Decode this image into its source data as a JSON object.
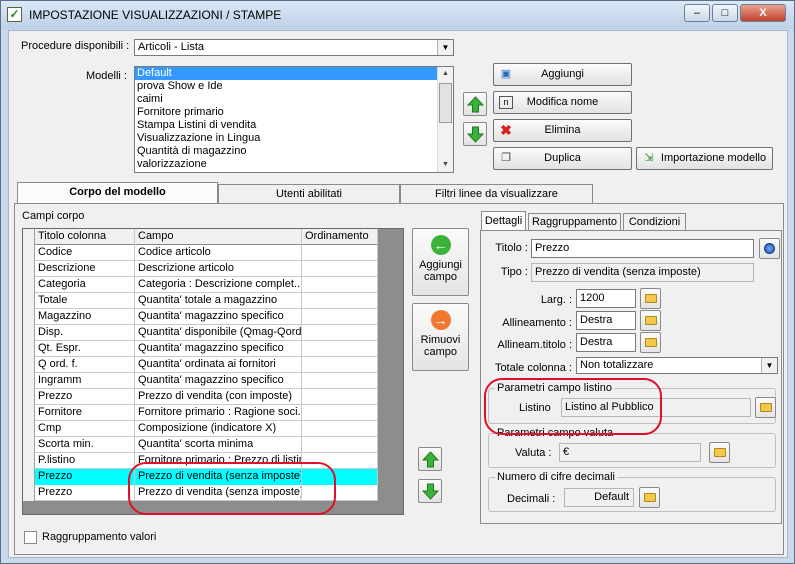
{
  "window": {
    "title": "IMPOSTAZIONE VISUALIZZAZIONI / STAMPE",
    "min": "–",
    "max": "□",
    "close": "X"
  },
  "top": {
    "procedure_label": "Procedure disponibili :",
    "procedure_value": "Articoli - Lista",
    "modelli_label": "Modelli :",
    "modelli": [
      "Default",
      "prova Show e Ide",
      "caimi",
      "Fornitore primario",
      "Stampa Listini di vendita",
      "Visualizzazione in Lingua",
      "Quantità di magazzino",
      "valorizzazione"
    ],
    "buttons": {
      "aggiungi": "Aggiungi",
      "modifica": "Modifica nome",
      "elimina": "Elimina",
      "duplica": "Duplica",
      "importazione": "Importazione modello"
    }
  },
  "tabs": [
    "Corpo del modello",
    "Utenti abilitati",
    "Filtri linee da visualizzare"
  ],
  "campi": {
    "label": "Campi corpo",
    "headers": [
      "Titolo colonna",
      "Campo",
      "Ordinamento"
    ],
    "rows": [
      [
        "Codice",
        "Codice articolo",
        ""
      ],
      [
        "Descrizione",
        "Descrizione articolo",
        ""
      ],
      [
        "Categoria",
        "Categoria : Descrizione complet...",
        ""
      ],
      [
        "Totale",
        "Quantita' totale a magazzino",
        ""
      ],
      [
        "Magazzino",
        "Quantita' magazzino specifico",
        ""
      ],
      [
        "Disp.",
        "Quantita' disponibile (Qmag-Qord)",
        ""
      ],
      [
        "Qt. Espr.",
        "Quantita' magazzino specifico",
        ""
      ],
      [
        "Q ord. f.",
        "Quantita' ordinata ai fornitori",
        ""
      ],
      [
        "Ingramm",
        "Quantita' magazzino specifico",
        ""
      ],
      [
        "Prezzo",
        "Prezzo di vendita (con imposte)",
        ""
      ],
      [
        "Fornitore",
        "Fornitore primario : Ragione soci...",
        ""
      ],
      [
        "Cmp",
        "Composizione (indicatore X)",
        ""
      ],
      [
        "Scorta min.",
        "Quantita' scorta minima",
        ""
      ],
      [
        "P.listino",
        "Fornitore primario : Prezzo di listino",
        ""
      ],
      [
        "Prezzo",
        "Prezzo di vendita (senza imposte)",
        ""
      ],
      [
        "Prezzo",
        "Prezzo di vendita (senza imposte)",
        ""
      ]
    ],
    "selected_row": 14,
    "aggiungi_campo": "Aggiungi campo",
    "rimuovi_campo": "Rimuovi campo",
    "raggruppamento_valori": "Raggruppamento valori"
  },
  "dettagli": {
    "subtabs": [
      "Dettagli",
      "Raggruppamento",
      "Condizioni"
    ],
    "titolo_label": "Titolo :",
    "titolo_value": "Prezzo",
    "tipo_label": "Tipo :",
    "tipo_value": "Prezzo di vendita (senza imposte)",
    "larg_label": "Larg. :",
    "larg_value": "1200",
    "allineamento_label": "Allineamento :",
    "allineamento_value": "Destra",
    "allineam_titolo_label": "Allineam.titolo :",
    "allineam_titolo_value": "Destra",
    "totale_label": "Totale colonna :",
    "totale_value": "Non totalizzare",
    "listino_group": "Parametri campo listino",
    "listino_label": "Listino",
    "listino_value": "Listino al Pubblico",
    "valuta_group": "Parametri campo valuta",
    "valuta_label": "Valuta :",
    "valuta_value": "€",
    "decimali_group": "Numero di cifre decimali",
    "decimali_label": "Decimali :",
    "decimali_value": "Default"
  },
  "colors": {
    "selection": "#3399ff",
    "highlight_row": "#00ffff",
    "annotation": "#e0102a",
    "arrow_green": "#3bb33b"
  }
}
